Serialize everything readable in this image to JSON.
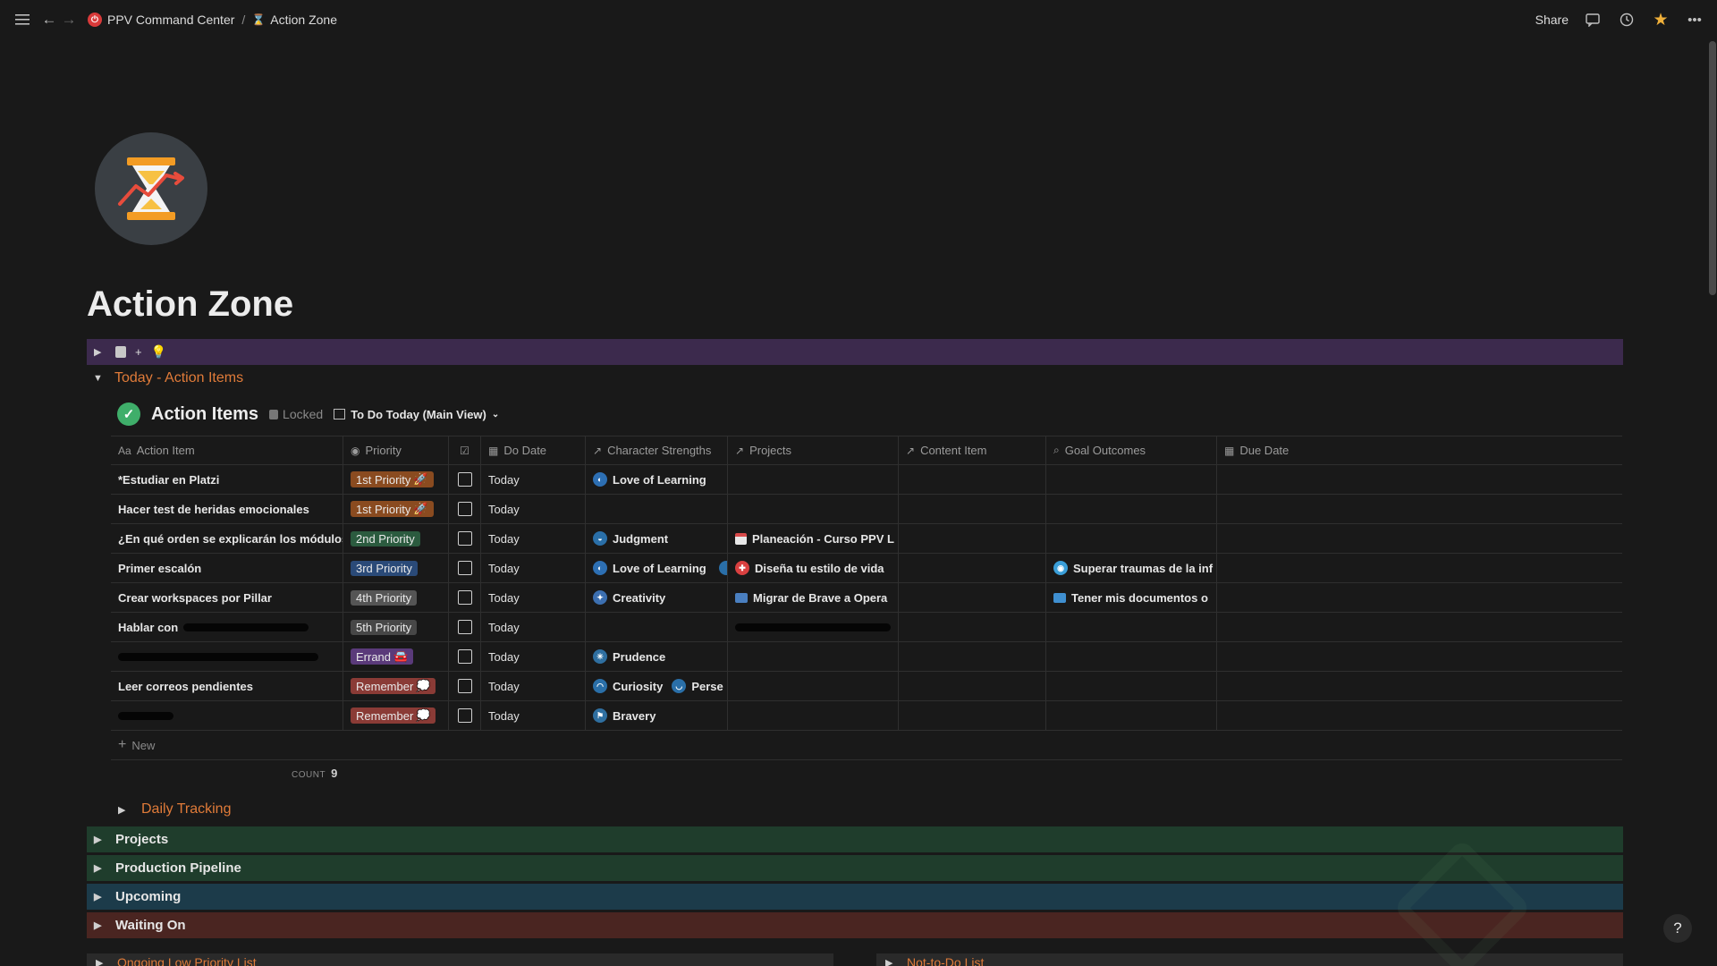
{
  "topbar": {
    "breadcrumbs": [
      {
        "label": "PPV Command Center",
        "icon": "power-icon"
      },
      {
        "label": "Action Zone",
        "icon": "hourglass-icon"
      }
    ],
    "separator": "/",
    "share_label": "Share"
  },
  "page": {
    "title": "Action Zone",
    "icon": "hourglass-icon"
  },
  "callout_bar": {
    "plus": "+",
    "color": "#3c2a4d"
  },
  "today_section": {
    "label": "Today - Action Items"
  },
  "database": {
    "name": "Action Items",
    "locked_label": "Locked",
    "view_label": "To Do Today (Main View)",
    "columns": [
      "Action Item",
      "Priority",
      "Do Date",
      "Character Strengths",
      "Projects",
      "Content Item",
      "Goal Outcomes",
      "Due Date"
    ],
    "rows": [
      {
        "name": "*Estudiar en Platzi",
        "priority": "1st Priority",
        "priority_color": "#8a4b20",
        "do_date": "Today",
        "strengths": [
          "Love of Learning"
        ],
        "projects": "",
        "goal": ""
      },
      {
        "name": "Hacer test de heridas emocionales",
        "priority": "1st Priority",
        "priority_color": "#8a4b20",
        "do_date": "Today",
        "strengths": [],
        "projects": "",
        "goal": ""
      },
      {
        "name": "¿En qué orden se explicarán los módulos",
        "priority": "2nd Priority",
        "priority_color": "#2b5b3f",
        "do_date": "Today",
        "strengths": [
          "Judgment"
        ],
        "projects": "Planeación - Curso PPV L",
        "goal": ""
      },
      {
        "name": "Primer escalón",
        "priority": "3rd Priority",
        "priority_color": "#2a4a78",
        "do_date": "Today",
        "strengths": [
          "Love of Learning"
        ],
        "projects": "Diseña tu estilo de vida",
        "goal": "Superar traumas de la inf"
      },
      {
        "name": "Crear workspaces por Pillar",
        "priority": "4th Priority",
        "priority_color": "#555555",
        "do_date": "Today",
        "strengths": [
          "Creativity"
        ],
        "projects": "Migrar de Brave a Opera",
        "goal": "Tener mis documentos o"
      },
      {
        "name": "Hablar con",
        "priority": "5th Priority",
        "priority_color": "#474747",
        "do_date": "Today",
        "strengths": [],
        "projects": "",
        "goal": ""
      },
      {
        "name": "",
        "priority": "Errand",
        "priority_color": "#5a3a7a",
        "do_date": "Today",
        "strengths": [
          "Prudence"
        ],
        "projects": "",
        "goal": ""
      },
      {
        "name": "Leer correos pendientes",
        "priority": "Remember",
        "priority_color": "#8a3b36",
        "do_date": "Today",
        "strengths": [
          "Curiosity",
          "Perse"
        ],
        "projects": "",
        "goal": ""
      },
      {
        "name": "",
        "priority": "Remember",
        "priority_color": "#8a3b36",
        "do_date": "Today",
        "strengths": [
          "Bravery"
        ],
        "projects": "",
        "goal": ""
      }
    ],
    "new_label": "New",
    "count_label": "COUNT",
    "count_value": "9"
  },
  "daily_tracking": {
    "label": "Daily Tracking"
  },
  "sections": [
    {
      "label": "Projects",
      "color": "#1f3d2c"
    },
    {
      "label": "Production Pipeline",
      "color": "#1f3d2c"
    },
    {
      "label": "Upcoming",
      "color": "#1c3b4a"
    },
    {
      "label": "Waiting On",
      "color": "#4a2521"
    }
  ],
  "bottom": {
    "left_label": "Ongoing Low Priority List",
    "right_label": "Not-to-Do List"
  },
  "help_label": "?"
}
